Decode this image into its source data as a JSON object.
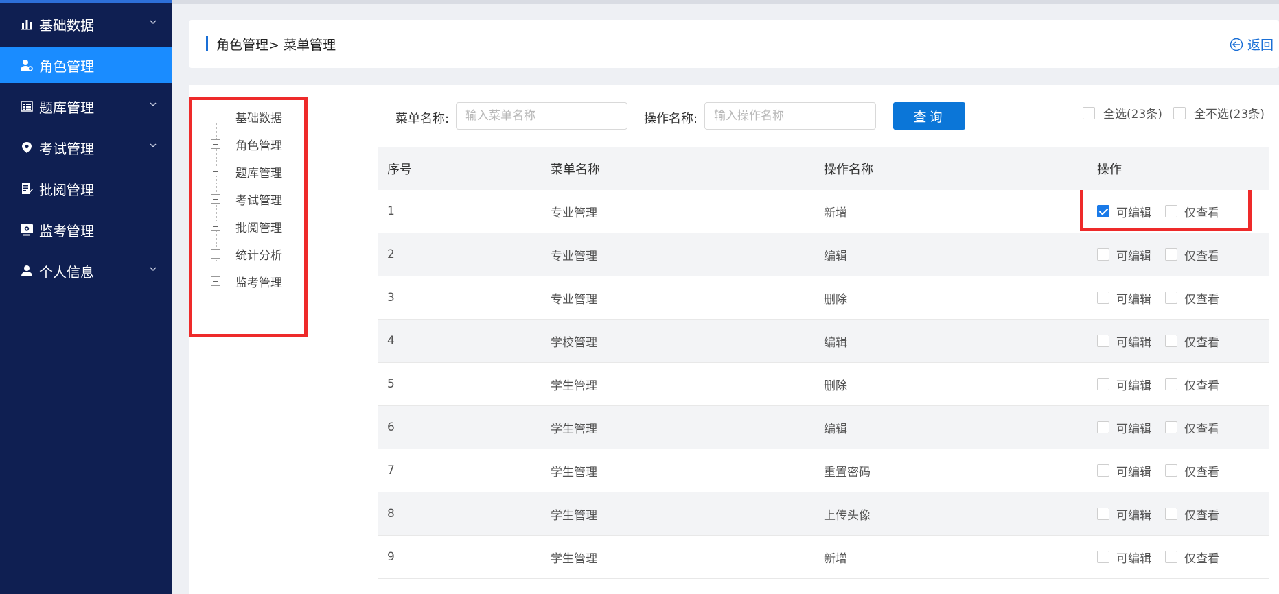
{
  "sidebar": {
    "items": [
      {
        "label": "基础数据",
        "icon": "bar-chart-icon",
        "has_children": true,
        "active": false
      },
      {
        "label": "角色管理",
        "icon": "user-gear-icon",
        "has_children": false,
        "active": true
      },
      {
        "label": "题库管理",
        "icon": "list-icon",
        "has_children": true,
        "active": false
      },
      {
        "label": "考试管理",
        "icon": "location-pin-icon",
        "has_children": true,
        "active": false
      },
      {
        "label": "批阅管理",
        "icon": "edit-doc-icon",
        "has_children": false,
        "active": false
      },
      {
        "label": "监考管理",
        "icon": "monitor-icon",
        "has_children": false,
        "active": false
      },
      {
        "label": "个人信息",
        "icon": "user-icon",
        "has_children": true,
        "active": false
      }
    ],
    "colors": {
      "bg": "#0f1f52",
      "active": "#1a8cff"
    }
  },
  "header": {
    "breadcrumb": "角色管理> 菜单管理",
    "back_label": "返回"
  },
  "tree": {
    "items": [
      "基础数据",
      "角色管理",
      "题库管理",
      "考试管理",
      "批阅管理",
      "统计分析",
      "监考管理"
    ]
  },
  "search": {
    "menu_label": "菜单名称:",
    "menu_placeholder": "输入菜单名称",
    "menu_value": "",
    "op_label": "操作名称:",
    "op_placeholder": "输入操作名称",
    "op_value": "",
    "query_label": "查询",
    "select_all": "全选(23条)",
    "select_none": "全不选(23条)"
  },
  "table": {
    "headers": [
      "序号",
      "菜单名称",
      "操作名称",
      "操作"
    ],
    "edit_label": "可编辑",
    "view_label": "仅查看",
    "rows": [
      {
        "idx": "1",
        "menu": "专业管理",
        "op": "新增",
        "editable": true,
        "viewonly": false
      },
      {
        "idx": "2",
        "menu": "专业管理",
        "op": "编辑",
        "editable": false,
        "viewonly": false
      },
      {
        "idx": "3",
        "menu": "专业管理",
        "op": "删除",
        "editable": false,
        "viewonly": false
      },
      {
        "idx": "4",
        "menu": "学校管理",
        "op": "编辑",
        "editable": false,
        "viewonly": false
      },
      {
        "idx": "5",
        "menu": "学生管理",
        "op": "删除",
        "editable": false,
        "viewonly": false
      },
      {
        "idx": "6",
        "menu": "学生管理",
        "op": "编辑",
        "editable": false,
        "viewonly": false
      },
      {
        "idx": "7",
        "menu": "学生管理",
        "op": "重置密码",
        "editable": false,
        "viewonly": false
      },
      {
        "idx": "8",
        "menu": "学生管理",
        "op": "上传头像",
        "editable": false,
        "viewonly": false
      },
      {
        "idx": "9",
        "menu": "学生管理",
        "op": "新增",
        "editable": false,
        "viewonly": false
      }
    ]
  },
  "colors": {
    "primary": "#0b76d8",
    "highlight": "#ee2a2a",
    "checkbox": "#1a7ae8"
  }
}
